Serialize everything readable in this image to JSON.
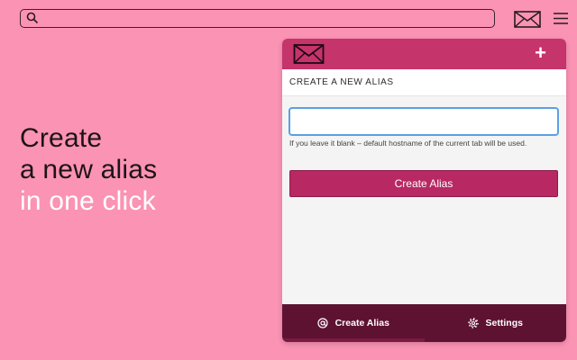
{
  "browser": {
    "search_value": "",
    "icons": {
      "search": "search-icon",
      "extension": "mail-icon",
      "menu": "hamburger-menu-icon"
    }
  },
  "promo": {
    "line1": "Create",
    "line2": "a new alias",
    "line3": "in one click"
  },
  "popup": {
    "header": {
      "logo_icon": "envelope-logo-icon",
      "add_label": "+"
    },
    "section_title": "CREATE A NEW ALIAS",
    "input": {
      "value": "",
      "placeholder": ""
    },
    "hint": "If you leave it blank – default hostname of the current tab will be used.",
    "create_button_label": "Create Alias",
    "footer": {
      "tabs": [
        {
          "label": "Create Alias",
          "icon": "at-icon",
          "active": true
        },
        {
          "label": "Settings",
          "icon": "gear-icon",
          "active": false
        }
      ]
    }
  },
  "colors": {
    "background": "#fb93b4",
    "header": "#c5346b",
    "button": "#b82863",
    "footer": "#5e1232",
    "input_focus": "#5aa0e6"
  }
}
